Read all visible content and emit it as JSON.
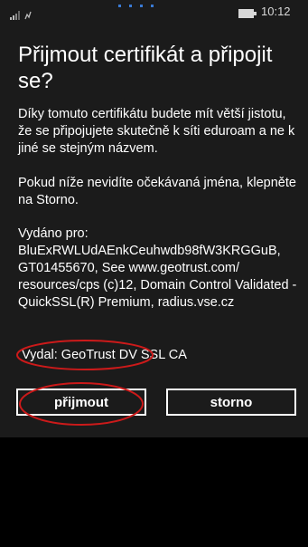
{
  "status": {
    "time": "10:12",
    "icons": [
      "signal-icon",
      "bluetooth-icon",
      "battery-icon"
    ]
  },
  "dialog": {
    "title": "Přijmout certifikát a připojit se?",
    "intro": "Díky tomuto certifikátu budete mít větší jistotu, že se připojujete skutečně k síti eduroam a ne k jiné se stejným názvem.",
    "hint": "Pokud níže nevidíte očekávaná jména, klepněte na Storno.",
    "issued_to_label": "Vydáno pro:",
    "issued_to_value": "BluExRWLUdAEnkCeuhwdb98fW3KRGGuB, GT01455670, See www.geotrust.com/ resources/cps (c)12, Domain Control Validated - QuickSSL(R) Premium, radius.vse.cz",
    "issuer": "Vydal: GeoTrust DV SSL CA"
  },
  "buttons": {
    "accept": "přijmout",
    "cancel": "storno"
  },
  "colors": {
    "background": "#1b1b1b",
    "text": "#ffffff",
    "highlight": "#cc1a1a"
  }
}
